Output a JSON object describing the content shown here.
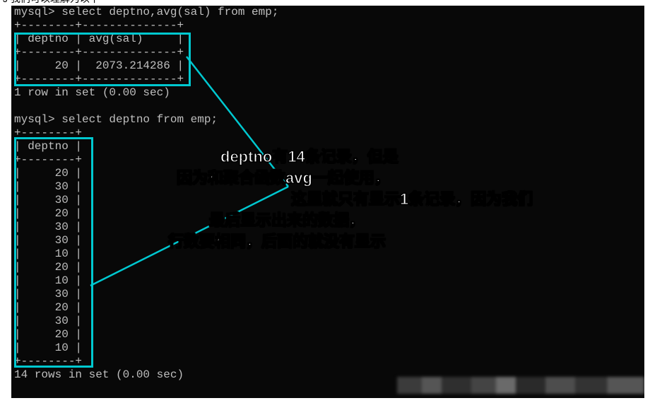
{
  "header_cropped": "J 我们可以理解为以下",
  "query1": {
    "prompt": "mysql>",
    "cmd": " select deptno,avg(sal) from emp;",
    "border_top": "+--------+--------------+",
    "header": "| deptno | avg(sal)     |",
    "border_mid": "+--------+--------------+",
    "row": "|     20 |  2073.214286 |",
    "border_bot": "+--------+--------------+",
    "status": "1 row in set (0.00 sec)"
  },
  "query2": {
    "prompt": "mysql>",
    "cmd": " select deptno from emp;",
    "border_top": "+--------+",
    "header": "| deptno |",
    "border_mid": "+--------+",
    "rows": [
      "|     20 |",
      "|     30 |",
      "|     30 |",
      "|     20 |",
      "|     30 |",
      "|     30 |",
      "|     10 |",
      "|     20 |",
      "|     10 |",
      "|     30 |",
      "|     20 |",
      "|     30 |",
      "|     20 |",
      "|     10 |"
    ],
    "border_bot": "+--------+",
    "status": "14 rows in set (0.00 sec)"
  },
  "annotation": {
    "l1": "deptno有14条记录，但是",
    "l2": "因为和聚合函数avg一起使用，",
    "l3": "这里就只有显示1条记录，因为我们",
    "l4": "最后显示出来的数据，",
    "l5": "行数要相同，后面的就没有显示"
  }
}
